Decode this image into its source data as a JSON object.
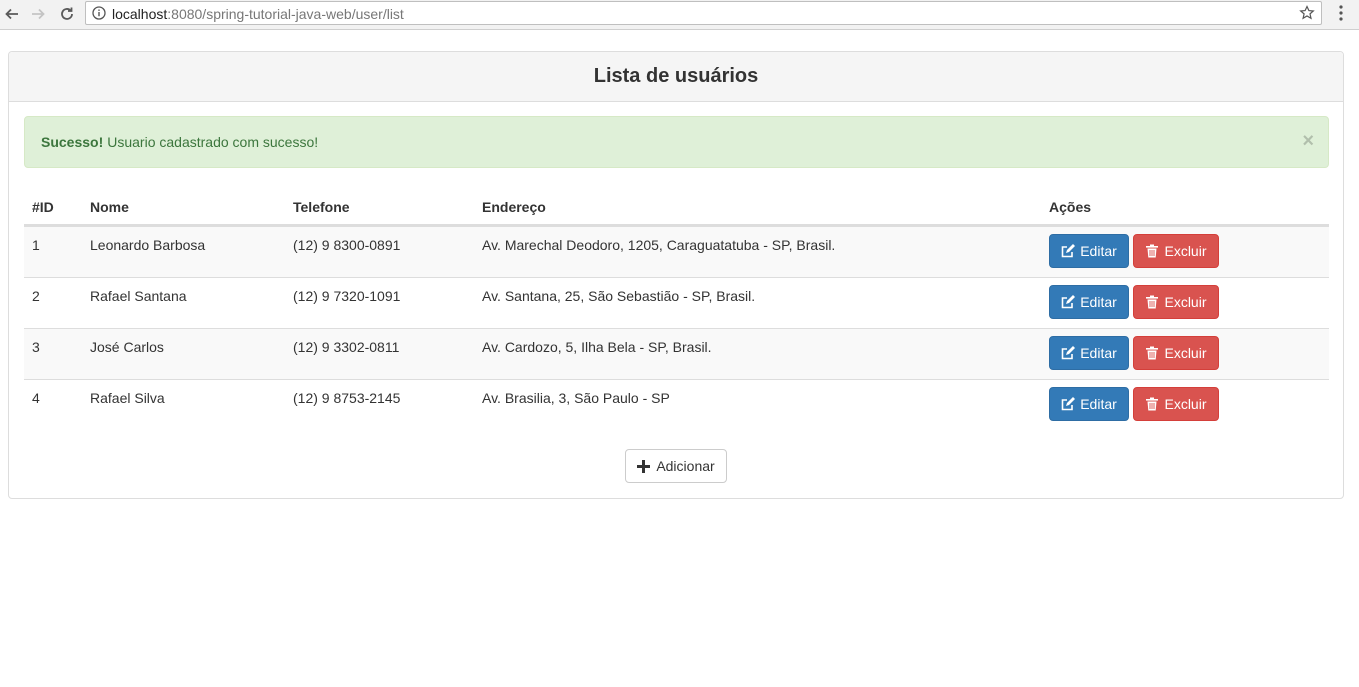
{
  "browser": {
    "url_host": "localhost",
    "url_path": ":8080/spring-tutorial-java-web/user/list"
  },
  "page": {
    "title": "Lista de usuários"
  },
  "alert": {
    "strong": "Sucesso!",
    "message": "Usuario cadastrado com sucesso!",
    "close": "×"
  },
  "table": {
    "headers": {
      "id": "#ID",
      "name": "Nome",
      "phone": "Telefone",
      "address": "Endereço",
      "actions": "Ações"
    },
    "rows": [
      {
        "id": "1",
        "name": "Leonardo Barbosa",
        "phone": "(12) 9 8300-0891",
        "address": "Av. Marechal Deodoro, 1205, Caraguatatuba - SP, Brasil."
      },
      {
        "id": "2",
        "name": "Rafael Santana",
        "phone": "(12) 9 7320-1091",
        "address": "Av. Santana, 25, São Sebastião - SP, Brasil."
      },
      {
        "id": "3",
        "name": "José Carlos",
        "phone": "(12) 9 3302-0811",
        "address": "Av. Cardozo, 5, Ilha Bela - SP, Brasil."
      },
      {
        "id": "4",
        "name": "Rafael Silva",
        "phone": "(12) 9 8753-2145",
        "address": "Av. Brasilia, 3, São Paulo - SP"
      }
    ],
    "edit_label": "Editar",
    "delete_label": "Excluir"
  },
  "add_label": "Adicionar",
  "colors": {
    "primary": "#337ab7",
    "danger": "#d9534f",
    "success_bg": "#dff0d8",
    "success_text": "#3c763d"
  },
  "icons": {
    "edit": "edit-icon",
    "delete": "trash-icon",
    "add": "plus-icon"
  }
}
